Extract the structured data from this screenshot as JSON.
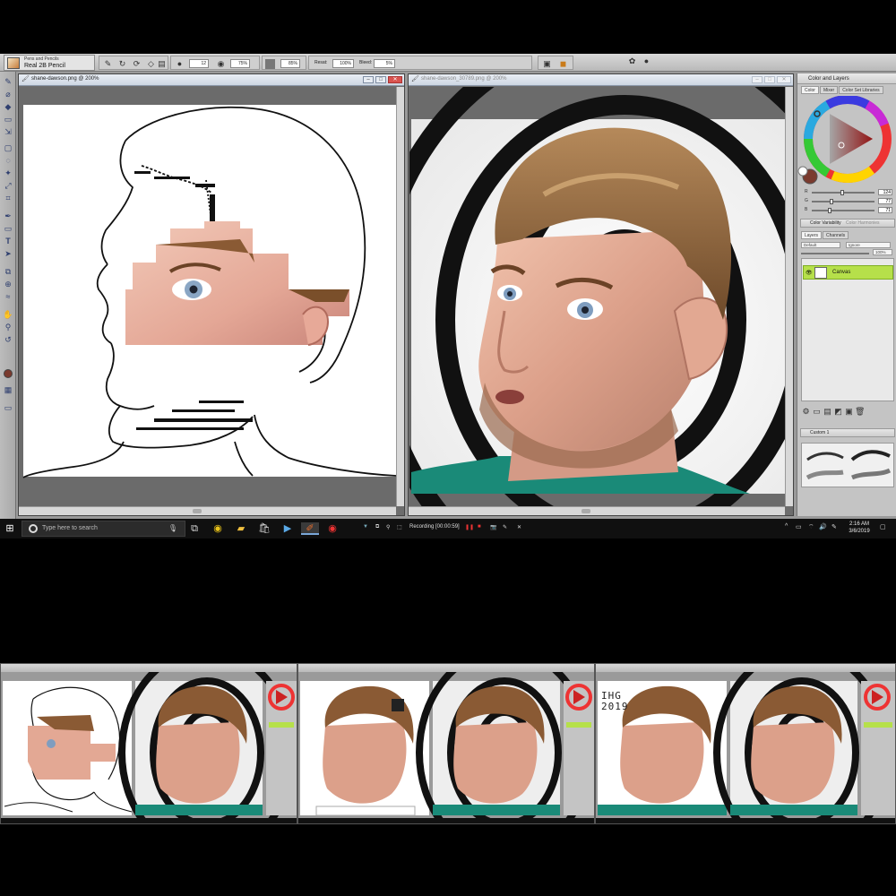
{
  "toolbar": {
    "brush_category": "Pens and Pencils",
    "brush_name": "Real 2B Pencil",
    "size_value": "12",
    "opacity_value": "75%",
    "grain_value": "85%",
    "resat_label": "Resat:",
    "resat_value": "100%",
    "bleed_label": "Bleed:",
    "bleed_value": "5%"
  },
  "left_document": {
    "title": "shane-dawson.png @ 200%"
  },
  "right_document": {
    "title": "shane-dawson_30789.png @ 200%"
  },
  "palette": {
    "title": "Color and Layers",
    "color_tabs": [
      "Color",
      "Mixer",
      "Color Set Libraries"
    ],
    "sliders": [
      {
        "label": "R",
        "value": "124",
        "level": 0.49
      },
      {
        "label": "G",
        "value": "77",
        "level": 0.3
      },
      {
        "label": "B",
        "value": "71",
        "level": 0.28
      }
    ],
    "color_variability_label": "Color Variability",
    "color_harmonies_label": "Color Harmonies",
    "layers_tabs": [
      "Layers",
      "Channels"
    ],
    "composite_method": "Default",
    "composite_source": "Ignore",
    "opacity_readout": "100%",
    "layer_name": "Canvas",
    "custom_palette_label": "Custom 1",
    "current_color": "#7a3a2e"
  },
  "taskbar": {
    "search_placeholder": "Type here to search",
    "recording_text": "Recording [00:00:59]",
    "time": "2:16 AM",
    "date": "3/6/2019"
  },
  "thumbnails": {
    "watermark_line1": "IHG",
    "watermark_line2": "2019"
  },
  "icons": [
    "search-icon",
    "microphone-icon",
    "task-view-icon",
    "chrome-icon",
    "file-explorer-icon",
    "store-icon",
    "media-icon",
    "painter-icon",
    "record-icon",
    "eye-icon"
  ]
}
